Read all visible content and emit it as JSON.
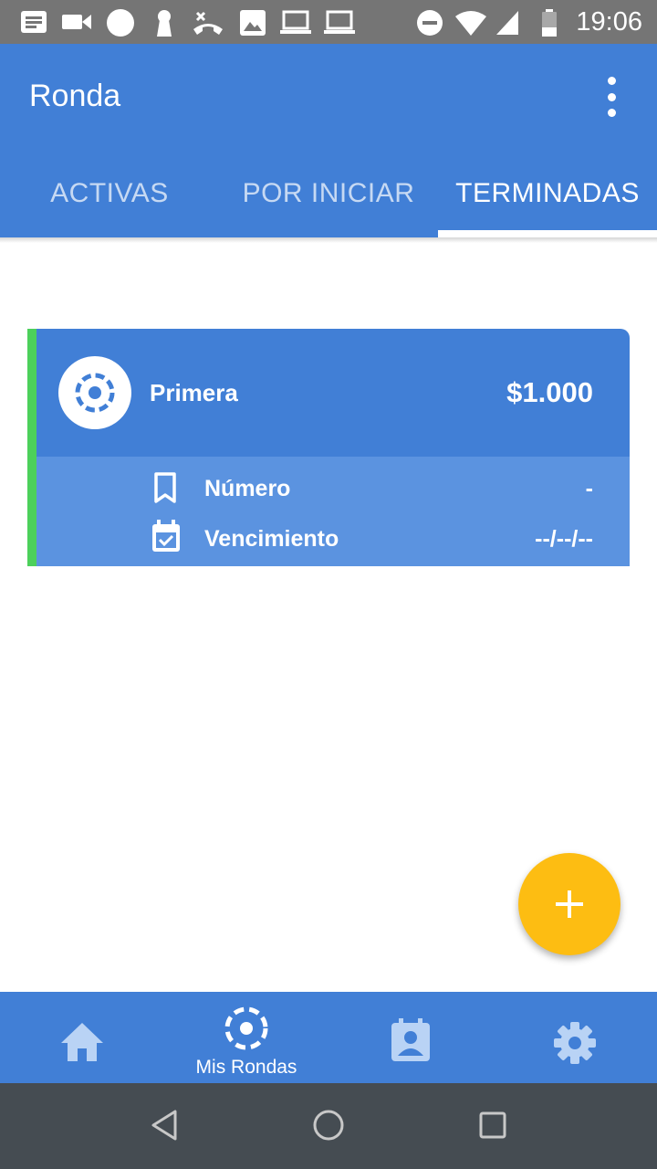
{
  "status_bar": {
    "time": "19:06",
    "icons": [
      "notes-icon",
      "video-icon",
      "circle-icon",
      "keyhole-icon",
      "call-end-icon",
      "image-icon",
      "laptop-icon",
      "laptop-icon",
      "do-not-disturb-icon",
      "wifi-icon",
      "signal-icon",
      "battery-icon"
    ]
  },
  "app_bar": {
    "title": "Ronda",
    "menu_icon": "more-vert-icon",
    "tabs": [
      {
        "label": "ACTIVAS",
        "selected": false
      },
      {
        "label": "POR INICIAR",
        "selected": false
      },
      {
        "label": "TERMINADAS",
        "selected": true
      }
    ]
  },
  "colors": {
    "primary": "#417fd6",
    "primary_light": "#5b93e0",
    "accent_green": "#4cd05b",
    "fab": "#fdbd12",
    "status_bar": "#757575",
    "system_nav": "#454c52"
  },
  "ronda_card": {
    "name": "Primera",
    "amount": "$1.000",
    "avatar_icon": "ronda-circle-icon",
    "rows": [
      {
        "icon": "bookmark-icon",
        "label": "Número",
        "value": "-"
      },
      {
        "icon": "calendar-check-icon",
        "label": "Vencimiento",
        "value": "--/--/--"
      }
    ]
  },
  "fab": {
    "icon": "plus-icon"
  },
  "bottom_nav": {
    "items": [
      {
        "icon": "home-icon",
        "label": "",
        "selected": false
      },
      {
        "icon": "ronda-circle-icon",
        "label": "Mis Rondas",
        "selected": true
      },
      {
        "icon": "contact-calendar-icon",
        "label": "",
        "selected": false
      },
      {
        "icon": "settings-icon",
        "label": "",
        "selected": false
      }
    ]
  },
  "system_nav": {
    "items": [
      "back-icon",
      "home-circle-icon",
      "recents-icon"
    ]
  }
}
